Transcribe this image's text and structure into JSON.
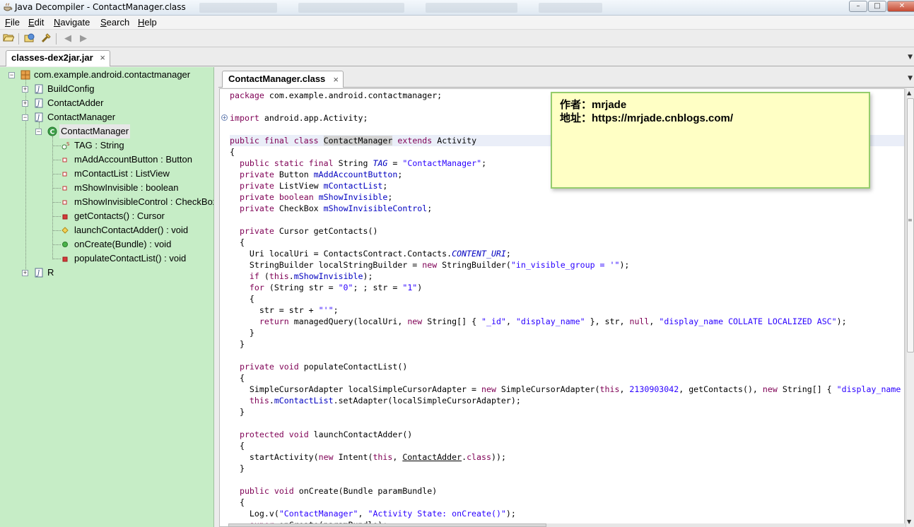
{
  "window": {
    "title": "Java Decompiler - ContactManager.class",
    "controls": {
      "minimize": "–",
      "maximize": "□",
      "close": "✕"
    }
  },
  "menu": [
    {
      "label": "File",
      "mnemonic": "F",
      "rest": "ile"
    },
    {
      "label": "Edit",
      "mnemonic": "E",
      "rest": "dit"
    },
    {
      "label": "Navigate",
      "mnemonic": "N",
      "rest": "avigate"
    },
    {
      "label": "Search",
      "mnemonic": "S",
      "rest": "earch"
    },
    {
      "label": "Help",
      "mnemonic": "H",
      "rest": "elp"
    }
  ],
  "toolbar": {
    "icons": [
      "open-file-icon",
      "open-type-icon",
      "open-type-hierarchy-icon",
      "back-arrow-icon",
      "forward-arrow-icon"
    ]
  },
  "outer_tab": {
    "label": "classes-dex2jar.jar",
    "close": "×"
  },
  "tree": {
    "package": "com.example.android.contactmanager",
    "items": [
      {
        "label": "BuildConfig"
      },
      {
        "label": "ContactAdder"
      },
      {
        "label": "ContactManager"
      },
      {
        "label": "ContactManager"
      },
      {
        "label": "TAG : String"
      },
      {
        "label": "mAddAccountButton : Button"
      },
      {
        "label": "mContactList : ListView"
      },
      {
        "label": "mShowInvisible : boolean"
      },
      {
        "label": "mShowInvisibleControl : CheckBox"
      },
      {
        "label": "getContacts() : Cursor"
      },
      {
        "label": "launchContactAdder() : void"
      },
      {
        "label": "onCreate(Bundle) : void"
      },
      {
        "label": "populateContactList() : void"
      },
      {
        "label": "R"
      }
    ]
  },
  "inner_tab": {
    "label": "ContactManager.class",
    "close": "×"
  },
  "note": {
    "line1": "作者：mrjade",
    "line2": "地址：https://mrjade.cnblogs.com/"
  },
  "code_lines": [
    "package com.example.android.contactmanager;",
    "",
    "import android.app.Activity;",
    "",
    "public final class ContactManager extends Activity",
    "{",
    "  public static final String TAG = \"ContactManager\";",
    "  private Button mAddAccountButton;",
    "  private ListView mContactList;",
    "  private boolean mShowInvisible;",
    "  private CheckBox mShowInvisibleControl;",
    "",
    "  private Cursor getContacts()",
    "  {",
    "    Uri localUri = ContactsContract.Contacts.CONTENT_URI;",
    "    StringBuilder localStringBuilder = new StringBuilder(\"in_visible_group = '\");",
    "    if (this.mShowInvisible);",
    "    for (String str = \"0\"; ; str = \"1\")",
    "    {",
    "      str = str + \"'\";",
    "      return managedQuery(localUri, new String[] { \"_id\", \"display_name\" }, str, null, \"display_name COLLATE LOCALIZED ASC\");",
    "    }",
    "  }",
    "",
    "  private void populateContactList()",
    "  {",
    "    SimpleCursorAdapter localSimpleCursorAdapter = new SimpleCursorAdapter(this, 2130903042, getContacts(), new String[] { \"display_name",
    "    this.mContactList.setAdapter(localSimpleCursorAdapter);",
    "  }",
    "",
    "  protected void launchContactAdder()",
    "  {",
    "    startActivity(new Intent(this, ContactAdder.class));",
    "  }",
    "",
    "  public void onCreate(Bundle paramBundle)",
    "  {",
    "    Log.v(\"ContactManager\", \"Activity State: onCreate()\");",
    "    super.onCreate(paramBundle);"
  ]
}
